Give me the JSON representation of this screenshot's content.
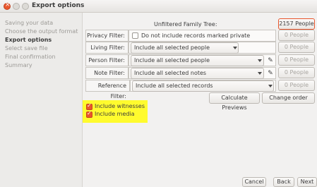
{
  "window": {
    "title": "Export options"
  },
  "sidebar": {
    "steps": [
      {
        "label": "Saving your data"
      },
      {
        "label": "Choose the output format"
      },
      {
        "label": "Export options"
      },
      {
        "label": "Select save file"
      },
      {
        "label": "Final confirmation"
      },
      {
        "label": "Summary"
      }
    ]
  },
  "tree": {
    "label": "Unfiltered Family Tree:",
    "count": "2157 People"
  },
  "filters": {
    "privacy": {
      "label": "Privacy Filter:",
      "checkbox_label": "Do not include records marked private",
      "count": "0 People"
    },
    "living": {
      "label": "Living Filter:",
      "value": "Include all selected people",
      "count": "0 People"
    },
    "person": {
      "label": "Person Filter:",
      "value": "Include all selected people",
      "count": "0 People"
    },
    "note": {
      "label": "Note Filter:",
      "value": "Include all selected notes",
      "count": "0 People"
    },
    "reference": {
      "label": "Reference Filter:",
      "value": "Include all selected records",
      "count": "0 People"
    }
  },
  "actions": {
    "calculate": "Calculate Previews",
    "change_order": "Change order"
  },
  "options": {
    "witnesses": "Include witnesses",
    "media": "Include media"
  },
  "footer": {
    "cancel": "Cancel",
    "back": "Back",
    "next": "Next"
  },
  "colors": {
    "accent": "#e9562c",
    "highlight": "#fffb2e"
  }
}
